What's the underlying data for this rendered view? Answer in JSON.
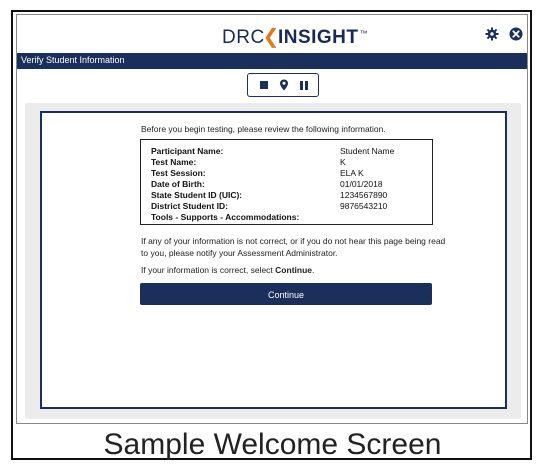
{
  "app": {
    "logo_left": "DRC",
    "logo_right": "INSIGHT",
    "logo_tm": "™",
    "title": "Verify Student Information"
  },
  "icons": {
    "settings": "gear-icon",
    "close": "close-icon",
    "stop": "stop-icon",
    "location": "map-pin-icon",
    "pause": "pause-icon"
  },
  "colors": {
    "brand_navy": "#1b2f5c",
    "accent_orange": "#e07a20"
  },
  "intro_text": "Before you begin testing, please review the following information.",
  "student_info": [
    {
      "label": "Participant Name:",
      "value": "Student Name"
    },
    {
      "label": "Test Name:",
      "value": "K"
    },
    {
      "label": "Test Session:",
      "value": "ELA K"
    },
    {
      "label": "Date of Birth:",
      "value": "01/01/2018"
    },
    {
      "label": "State Student ID (UIC):",
      "value": "1234567890"
    },
    {
      "label": "District Student ID:",
      "value": "9876543210"
    },
    {
      "label": "Tools - Supports - Accommodations:",
      "value": ""
    }
  ],
  "notice_line1": "If any of your information is not correct, or if you do not hear this page being read",
  "notice_line2": "to you, please notify your Assessment Administrator.",
  "confirm_prefix": "If your information is correct, select ",
  "confirm_bold": "Continue",
  "confirm_suffix": ".",
  "continue_label": "Continue",
  "caption": "Sample Welcome Screen"
}
